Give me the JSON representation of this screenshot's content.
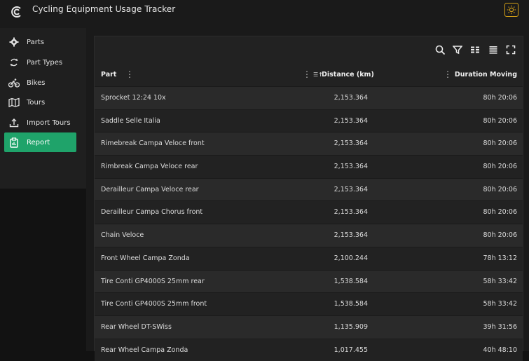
{
  "app": {
    "title": "Cycling Equipment Usage Tracker"
  },
  "sidebar": {
    "items": [
      {
        "label": "Parts",
        "icon": "gear-icon"
      },
      {
        "label": "Part Types",
        "icon": "cycle-arrows-icon"
      },
      {
        "label": "Bikes",
        "icon": "bike-icon"
      },
      {
        "label": "Tours",
        "icon": "map-icon"
      },
      {
        "label": "Import Tours",
        "icon": "upload-icon"
      },
      {
        "label": "Report",
        "icon": "clipboard-icon",
        "active": true
      }
    ]
  },
  "table": {
    "columns": {
      "part": "Part",
      "distance": "Distance (km)",
      "duration": "Duration Moving"
    },
    "rows": [
      {
        "part": "Sprocket 12:24 10x",
        "distance": "2,153.364",
        "duration": "80h 20:06"
      },
      {
        "part": "Saddle Selle Italia",
        "distance": "2,153.364",
        "duration": "80h 20:06"
      },
      {
        "part": "Rimebreak Campa Veloce front",
        "distance": "2,153.364",
        "duration": "80h 20:06"
      },
      {
        "part": "Rimbreak Campa Veloce rear",
        "distance": "2,153.364",
        "duration": "80h 20:06"
      },
      {
        "part": "Derailleur Campa Veloce rear",
        "distance": "2,153.364",
        "duration": "80h 20:06"
      },
      {
        "part": "Derailleur Campa Chorus front",
        "distance": "2,153.364",
        "duration": "80h 20:06"
      },
      {
        "part": "Chain Veloce",
        "distance": "2,153.364",
        "duration": "80h 20:06"
      },
      {
        "part": "Front Wheel Campa Zonda",
        "distance": "2,100.244",
        "duration": "78h 13:12"
      },
      {
        "part": "Tire Conti GP4000S 25mm rear",
        "distance": "1,538.584",
        "duration": "58h 33:42"
      },
      {
        "part": "Tire Conti GP4000S 25mm front",
        "distance": "1,538.584",
        "duration": "58h 33:42"
      },
      {
        "part": "Rear Wheel DT-SWiss",
        "distance": "1,135.909",
        "duration": "39h 31:56"
      },
      {
        "part": "Rear Wheel Campa Zonda",
        "distance": "1,017.455",
        "duration": "40h 48:10"
      }
    ]
  },
  "colors": {
    "accent": "#1fa36a",
    "theme_toggle": "#d4a017"
  }
}
